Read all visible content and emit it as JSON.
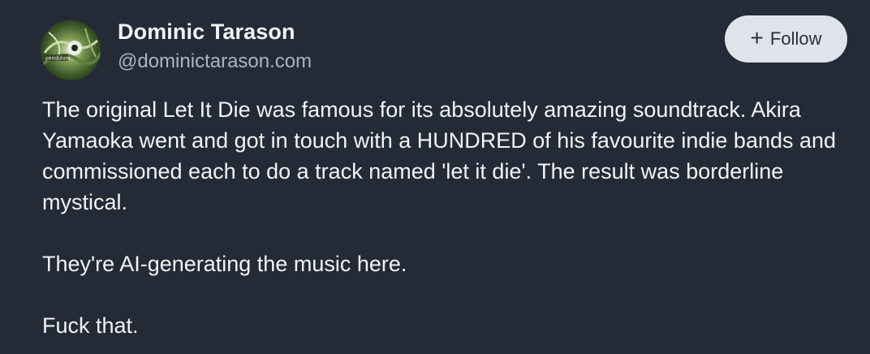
{
  "post": {
    "author": {
      "display_name": "Dominic Tarason",
      "handle": "@dominictarason.com",
      "avatar_icon": "avatar-image"
    },
    "follow_button": {
      "icon": "plus-icon",
      "label": "Follow"
    },
    "paragraphs": [
      "The original Let It Die was famous for its absolutely amazing soundtrack. Akira Yamaoka went and got in touch with a HUNDRED of his favourite indie bands and commissioned each to do a track named 'let it die'. The result was borderline mystical.",
      "They're AI-generating the music here.",
      "Fuck that."
    ]
  },
  "colors": {
    "background": "#252b36",
    "text_primary": "#f1f3f5",
    "text_secondary": "#aab4c3",
    "button_bg": "#dfe3ea",
    "button_text": "#2a313c"
  }
}
